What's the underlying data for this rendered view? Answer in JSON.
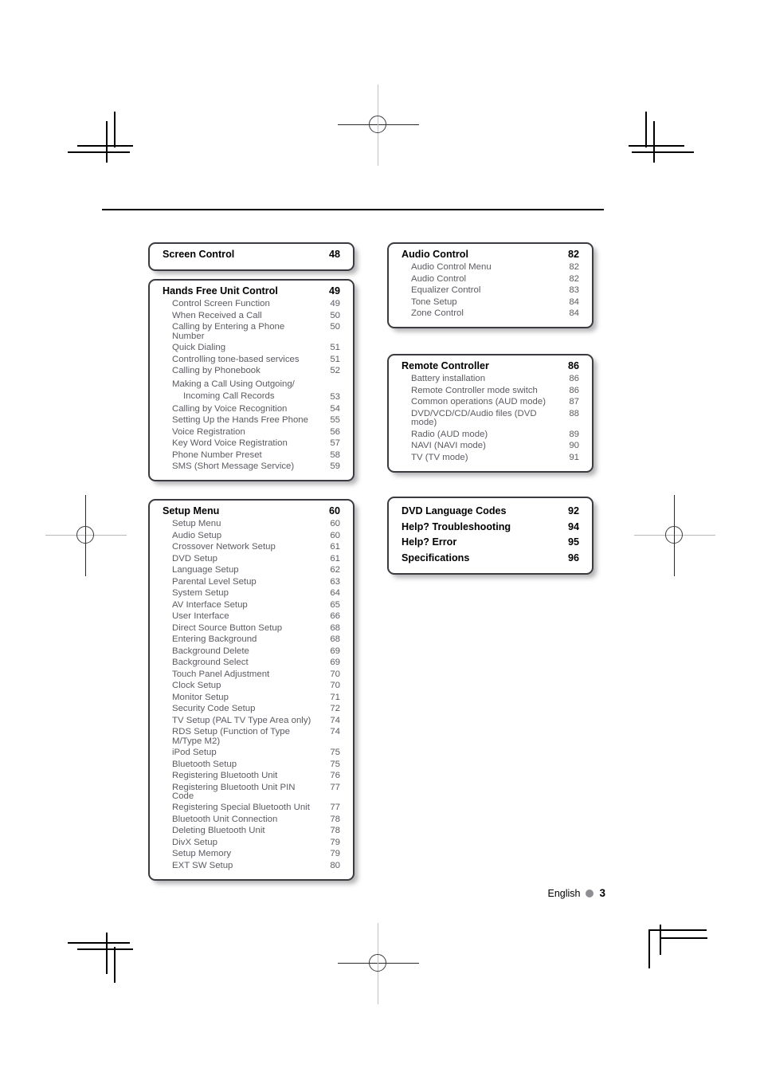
{
  "page": {
    "footer_language": "English",
    "footer_page_number": "3",
    "footer_dot_color": "#8e8e93",
    "box_border_color": "#3a3a40",
    "entry_text_color": "#5b5b62"
  },
  "boxes": [
    {
      "name": "screen-control",
      "header": {
        "label": "Screen Control",
        "page": "48"
      },
      "entries": []
    },
    {
      "name": "hands-free-unit-control",
      "header": {
        "label": "Hands Free Unit Control",
        "page": "49"
      },
      "entries": [
        {
          "label": "Control Screen Function",
          "page": "49"
        },
        {
          "label": "When Received a Call",
          "page": "50"
        },
        {
          "label": "Calling by Entering a Phone Number",
          "page": "50"
        },
        {
          "label": "Quick Dialing",
          "page": "51"
        },
        {
          "label": "Controlling tone-based services",
          "page": "51"
        },
        {
          "label": "Calling by Phonebook",
          "page": "52"
        },
        {
          "label": "Making a Call Using Outgoing/",
          "label2": "Incoming Call Records",
          "page": "53",
          "wrap": true
        },
        {
          "label": "Calling by Voice Recognition",
          "page": "54"
        },
        {
          "label": "Setting Up the Hands Free Phone",
          "page": "55"
        },
        {
          "label": "Voice Registration",
          "page": "56"
        },
        {
          "label": "Key Word Voice Registration",
          "page": "57"
        },
        {
          "label": "Phone Number Preset",
          "page": "58"
        },
        {
          "label": "SMS (Short Message Service)",
          "page": "59"
        }
      ]
    },
    {
      "name": "setup-menu",
      "header": {
        "label": "Setup Menu",
        "page": "60"
      },
      "entries": [
        {
          "label": "Setup Menu",
          "page": "60"
        },
        {
          "label": "Audio Setup",
          "page": "60"
        },
        {
          "label": "Crossover Network Setup",
          "page": "61"
        },
        {
          "label": "DVD Setup",
          "page": "61"
        },
        {
          "label": "Language Setup",
          "page": "62"
        },
        {
          "label": "Parental Level Setup",
          "page": "63"
        },
        {
          "label": "System Setup",
          "page": "64"
        },
        {
          "label": "AV Interface Setup",
          "page": "65"
        },
        {
          "label": "User Interface",
          "page": "66"
        },
        {
          "label": "Direct Source Button Setup",
          "page": "68"
        },
        {
          "label": "Entering Background",
          "page": "68"
        },
        {
          "label": "Background Delete",
          "page": "69"
        },
        {
          "label": "Background Select",
          "page": "69"
        },
        {
          "label": "Touch Panel Adjustment",
          "page": "70"
        },
        {
          "label": "Clock Setup",
          "page": "70"
        },
        {
          "label": "Monitor Setup",
          "page": "71"
        },
        {
          "label": "Security Code Setup",
          "page": "72"
        },
        {
          "label": "TV Setup (PAL TV Type Area only)",
          "page": "74"
        },
        {
          "label": "RDS Setup (Function of Type M/Type M2)",
          "page": "74"
        },
        {
          "label": "iPod Setup",
          "page": "75"
        },
        {
          "label": "Bluetooth Setup",
          "page": "75"
        },
        {
          "label": "Registering Bluetooth Unit",
          "page": "76"
        },
        {
          "label": "Registering Bluetooth Unit PIN Code",
          "page": "77"
        },
        {
          "label": "Registering Special Bluetooth Unit",
          "page": "77"
        },
        {
          "label": "Bluetooth Unit Connection",
          "page": "78"
        },
        {
          "label": "Deleting Bluetooth Unit",
          "page": "78"
        },
        {
          "label": "DivX Setup",
          "page": "79"
        },
        {
          "label": "Setup Memory",
          "page": "79"
        },
        {
          "label": "EXT SW Setup",
          "page": "80"
        }
      ]
    },
    {
      "name": "audio-control",
      "header": {
        "label": "Audio Control",
        "page": "82"
      },
      "entries": [
        {
          "label": "Audio Control Menu",
          "page": "82"
        },
        {
          "label": "Audio Control",
          "page": "82"
        },
        {
          "label": "Equalizer Control",
          "page": "83"
        },
        {
          "label": "Tone Setup",
          "page": "84"
        },
        {
          "label": "Zone Control",
          "page": "84"
        }
      ]
    },
    {
      "name": "remote-controller",
      "header": {
        "label": "Remote Controller",
        "page": "86"
      },
      "entries": [
        {
          "label": "Battery installation",
          "page": "86"
        },
        {
          "label": "Remote Controller mode switch",
          "page": "86"
        },
        {
          "label": "Common operations (AUD mode)",
          "page": "87"
        },
        {
          "label": "DVD/VCD/CD/Audio files (DVD mode)",
          "page": "88"
        },
        {
          "label": "Radio (AUD mode)",
          "page": "89"
        },
        {
          "label": "NAVI (NAVI mode)",
          "page": "90"
        },
        {
          "label": "TV (TV mode)",
          "page": "91"
        }
      ]
    },
    {
      "name": "appendix",
      "bold_rows": [
        {
          "label": "DVD Language Codes",
          "page": "92"
        },
        {
          "label": "Help? Troubleshooting",
          "page": "94"
        },
        {
          "label": "Help? Error",
          "page": "95"
        },
        {
          "label": "Specifications",
          "page": "96"
        }
      ],
      "entries": []
    }
  ]
}
